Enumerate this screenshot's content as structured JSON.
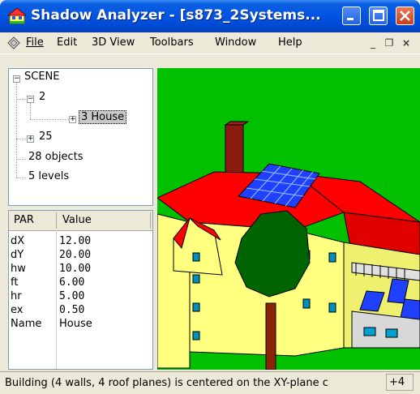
{
  "window": {
    "title": "Shadow Analyzer - [s873_2Systems..."
  },
  "menubar": {
    "items": [
      {
        "label": "File",
        "mnemonic_index": 0
      },
      {
        "label": "Edit"
      },
      {
        "label": "3D View"
      },
      {
        "label": "Toolbars"
      },
      {
        "label": "Window"
      },
      {
        "label": "Help"
      }
    ],
    "mdi_minimize": "_",
    "mdi_restore": "❐",
    "mdi_close": "×"
  },
  "tree": {
    "root": "SCENE",
    "child_2": "2",
    "child_3_house": "3 House",
    "child_25": "25",
    "objects": "28 objects",
    "levels": "5 levels",
    "expand_minus": "−",
    "expand_plus": "+"
  },
  "properties": {
    "columns": [
      "PAR",
      "Value"
    ],
    "rows": [
      {
        "par": "dX",
        "value": "12.00"
      },
      {
        "par": "dY",
        "value": "20.00"
      },
      {
        "par": "hw",
        "value": "10.00"
      },
      {
        "par": "ft",
        "value": "6.00"
      },
      {
        "par": "hr",
        "value": "5.00"
      },
      {
        "par": "ex",
        "value": "0.50"
      },
      {
        "par": "Name",
        "value": "House"
      }
    ]
  },
  "statusbar": {
    "text": "Building (4 walls, 4 roof planes) is centered on the XY-plane c",
    "pane": "+4"
  },
  "colors": {
    "ground": "#00c000",
    "roof": "#ff0000",
    "walls": "#ffff80",
    "solar_panel": "#2040ff",
    "tree_crown": "#006400",
    "trunk": "#8b2500"
  }
}
